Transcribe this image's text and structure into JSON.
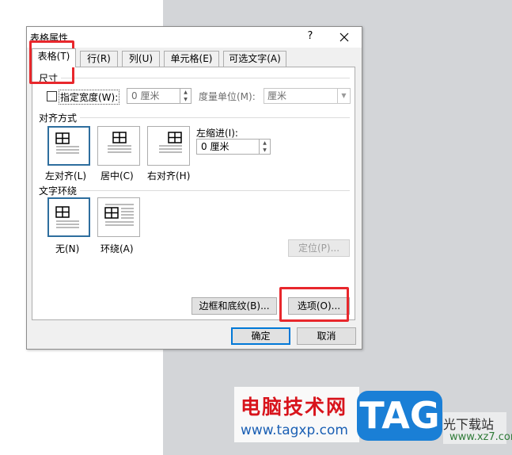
{
  "dialog": {
    "title": "表格属性",
    "help_label": "?",
    "tabs": [
      {
        "label": "表格(T)",
        "active": true
      },
      {
        "label": "行(R)"
      },
      {
        "label": "列(U)"
      },
      {
        "label": "单元格(E)"
      },
      {
        "label": "可选文字(A)"
      }
    ],
    "size": {
      "section_label": "尺寸",
      "preferred_width_label": "指定宽度(W):",
      "preferred_width_checked": false,
      "width_value": "0 厘米",
      "measure_label": "度量单位(M):",
      "measure_value": "厘米"
    },
    "alignment": {
      "section_label": "对齐方式",
      "options": [
        {
          "label": "左对齐(L)",
          "selected": true
        },
        {
          "label": "居中(C)"
        },
        {
          "label": "右对齐(H)"
        }
      ],
      "indent_label": "左缩进(I):",
      "indent_value": "0 厘米"
    },
    "wrapping": {
      "section_label": "文字环绕",
      "options": [
        {
          "label": "无(N)",
          "selected": true
        },
        {
          "label": "环绕(A)"
        }
      ],
      "position_button": "定位(P)..."
    },
    "borders_button": "边框和底纹(B)...",
    "options_button": "选项(O)...",
    "ok_button": "确定",
    "cancel_button": "取消"
  },
  "watermark": {
    "site_name": "电脑技术网",
    "site_url": "www.tagxp.com",
    "badge": "TAG",
    "right_text": "光下载站",
    "right_url": "www.xz7.com"
  },
  "colors": {
    "highlight": "#e8272c",
    "selected_border": "#2e6e9e",
    "default_button_border": "#0078d7",
    "workspace_bg": "#d3d5d8"
  }
}
